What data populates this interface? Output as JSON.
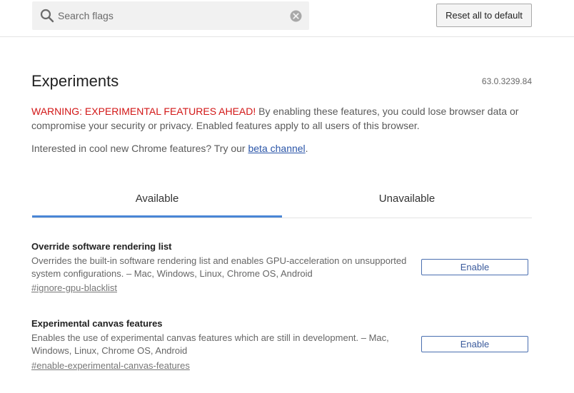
{
  "header": {
    "search": {
      "placeholder": "Search flags",
      "value": "",
      "icon": "search-icon",
      "clear_icon": "clear-icon"
    },
    "reset_label": "Reset all to default"
  },
  "main": {
    "title": "Experiments",
    "version": "63.0.3239.84",
    "warning_prefix": "WARNING: EXPERIMENTAL FEATURES AHEAD!",
    "warning_text": " By enabling these features, you could lose browser data or compromise your security or privacy. Enabled features apply to all users of this browser.",
    "interested_text": "Interested in cool new Chrome features? Try our ",
    "beta_link": "beta channel",
    "interested_suffix": ".",
    "tabs": [
      {
        "label": "Available",
        "selected": true
      },
      {
        "label": "Unavailable",
        "selected": false
      }
    ],
    "experiments": [
      {
        "title": "Override software rendering list",
        "description": "Overrides the built-in software rendering list and enables GPU-acceleration on unsupported system configurations. – Mac, Windows, Linux, Chrome OS, Android",
        "link": "#ignore-gpu-blacklist",
        "button_label": "Enable"
      },
      {
        "title": "Experimental canvas features",
        "description": "Enables the use of experimental canvas features which are still in development. – Mac, Windows, Linux, Chrome OS, Android",
        "link": "#enable-experimental-canvas-features",
        "button_label": "Enable"
      }
    ]
  },
  "colors": {
    "warning": "#d21616",
    "link": "#2a55a8",
    "tab_indicator": "#4a86d6",
    "enable_border": "#4a6fb0"
  }
}
